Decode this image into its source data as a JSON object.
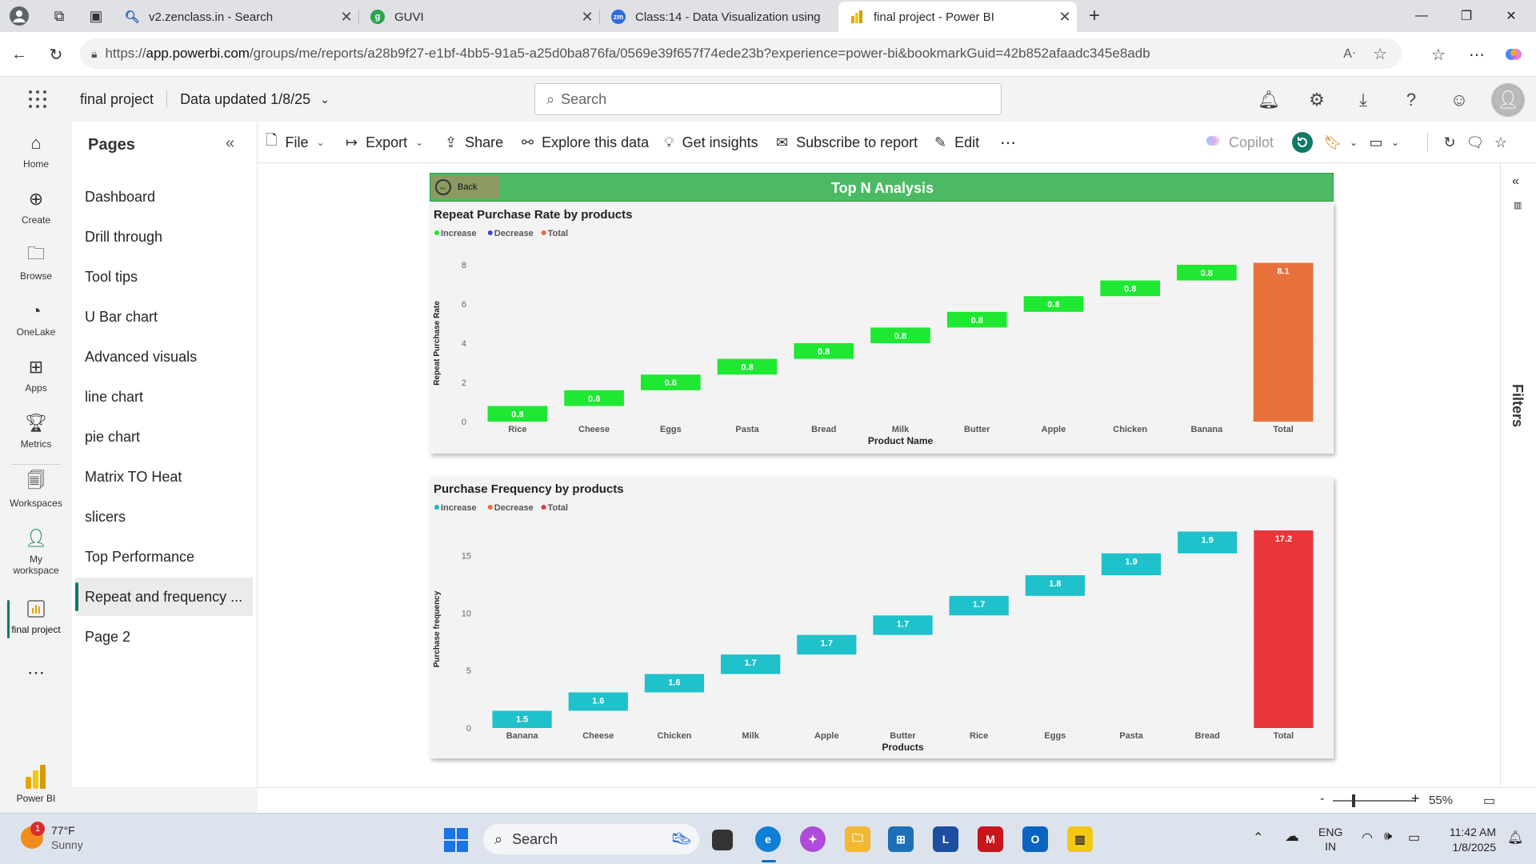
{
  "browser": {
    "tabs": [
      {
        "title": "v2.zenclass.in - Search"
      },
      {
        "title": "GUVI"
      },
      {
        "title": "Class:14 - Data Visualization using"
      },
      {
        "title": "final project - Power BI"
      }
    ],
    "url_prefix": "https://",
    "url_host": "app.powerbi.com",
    "url_path": "/groups/me/reports/a28b9f27-e1bf-4bb5-91a5-a25d0ba876fa/0569e39f657f74ede23b?experience=power-bi&bookmarkGuid=42b852afaadc345e8adb"
  },
  "header": {
    "report_name": "final project",
    "data_updated": "Data updated 1/8/25",
    "search_placeholder": "Search"
  },
  "leftnav": [
    {
      "label": "Home",
      "icon": "home-icon"
    },
    {
      "label": "Create",
      "icon": "plus-circle-icon"
    },
    {
      "label": "Browse",
      "icon": "folder-icon"
    },
    {
      "label": "OneLake",
      "icon": "onelake-icon"
    },
    {
      "label": "Apps",
      "icon": "apps-icon"
    },
    {
      "label": "Metrics",
      "icon": "trophy-icon"
    },
    {
      "label": "Workspaces",
      "icon": "workspaces-icon"
    },
    {
      "label": "My workspace",
      "icon": "person-icon"
    },
    {
      "label": "final project",
      "icon": "report-icon"
    }
  ],
  "brand": {
    "label": "Power BI"
  },
  "pages": {
    "title": "Pages",
    "items": [
      {
        "label": "Dashboard"
      },
      {
        "label": "Drill through"
      },
      {
        "label": "Tool tips"
      },
      {
        "label": "U Bar chart"
      },
      {
        "label": "Advanced visuals"
      },
      {
        "label": "line chart"
      },
      {
        "label": "pie chart"
      },
      {
        "label": "Matrix TO Heat"
      },
      {
        "label": "slicers"
      },
      {
        "label": "Top Performance"
      },
      {
        "label": "Repeat and frequency ..."
      },
      {
        "label": "Page 2"
      }
    ],
    "active_index": 10
  },
  "toolbar": {
    "file": "File",
    "export": "Export",
    "share": "Share",
    "explore": "Explore this data",
    "insights": "Get insights",
    "subscribe": "Subscribe to report",
    "edit": "Edit",
    "copilot": "Copilot"
  },
  "filters": {
    "label": "Filters"
  },
  "report": {
    "banner_title": "Top N Analysis",
    "back_label": "Back",
    "banner_color": "#4cba64"
  },
  "chart_data": [
    {
      "type": "waterfall",
      "title": "Repeat Purchase Rate by products",
      "legend": [
        {
          "name": "Increase",
          "color": "#1ee832"
        },
        {
          "name": "Decrease",
          "color": "#3b49d6"
        },
        {
          "name": "Total",
          "color": "#f0683c"
        }
      ],
      "xlabel": "Product Name",
      "ylabel": "Repeat Purchase Rate",
      "ylim": [
        0,
        8
      ],
      "yticks": [
        0,
        2,
        4,
        6,
        8
      ],
      "categories": [
        "Rice",
        "Cheese",
        "Eggs",
        "Pasta",
        "Bread",
        "Milk",
        "Butter",
        "Apple",
        "Chicken",
        "Banana",
        "Total"
      ],
      "values": [
        0.8,
        0.8,
        0.8,
        0.8,
        0.8,
        0.8,
        0.8,
        0.8,
        0.8,
        0.8,
        8.1
      ],
      "labels": [
        "0.8",
        "0.8",
        "0.8",
        "0.8",
        "0.8",
        "0.8",
        "0.8",
        "0.8",
        "0.8",
        "0.8",
        "8.1"
      ],
      "increase_color": "#1ee832",
      "total_color": "#e8703a"
    },
    {
      "type": "waterfall",
      "title": "Purchase Frequency by products",
      "legend": [
        {
          "name": "Increase",
          "color": "#1fb6c2"
        },
        {
          "name": "Decrease",
          "color": "#f0683c"
        },
        {
          "name": "Total",
          "color": "#e8363a"
        }
      ],
      "xlabel": "Products",
      "ylabel": "Purchase frequency",
      "ylim": [
        0,
        17.2
      ],
      "yticks": [
        0,
        5,
        10,
        15
      ],
      "categories": [
        "Banana",
        "Cheese",
        "Chicken",
        "Milk",
        "Apple",
        "Butter",
        "Rice",
        "Eggs",
        "Pasta",
        "Bread",
        "Total"
      ],
      "values": [
        1.5,
        1.6,
        1.6,
        1.7,
        1.7,
        1.7,
        1.7,
        1.8,
        1.9,
        1.9,
        17.2
      ],
      "labels": [
        "1.5",
        "1.6",
        "1.6",
        "1.7",
        "1.7",
        "1.7",
        "1.7",
        "1.8",
        "1.9",
        "1.9",
        "17.2"
      ],
      "increase_color": "#1fc1ca",
      "total_color": "#e8363a"
    }
  ],
  "statusbar": {
    "zoom": "55%"
  },
  "taskbar": {
    "temperature": "77°F",
    "condition": "Sunny",
    "weather_badge": "1",
    "search": "Search",
    "lang": "ENG",
    "region": "IN",
    "time": "11:42 AM",
    "date": "1/8/2025"
  }
}
